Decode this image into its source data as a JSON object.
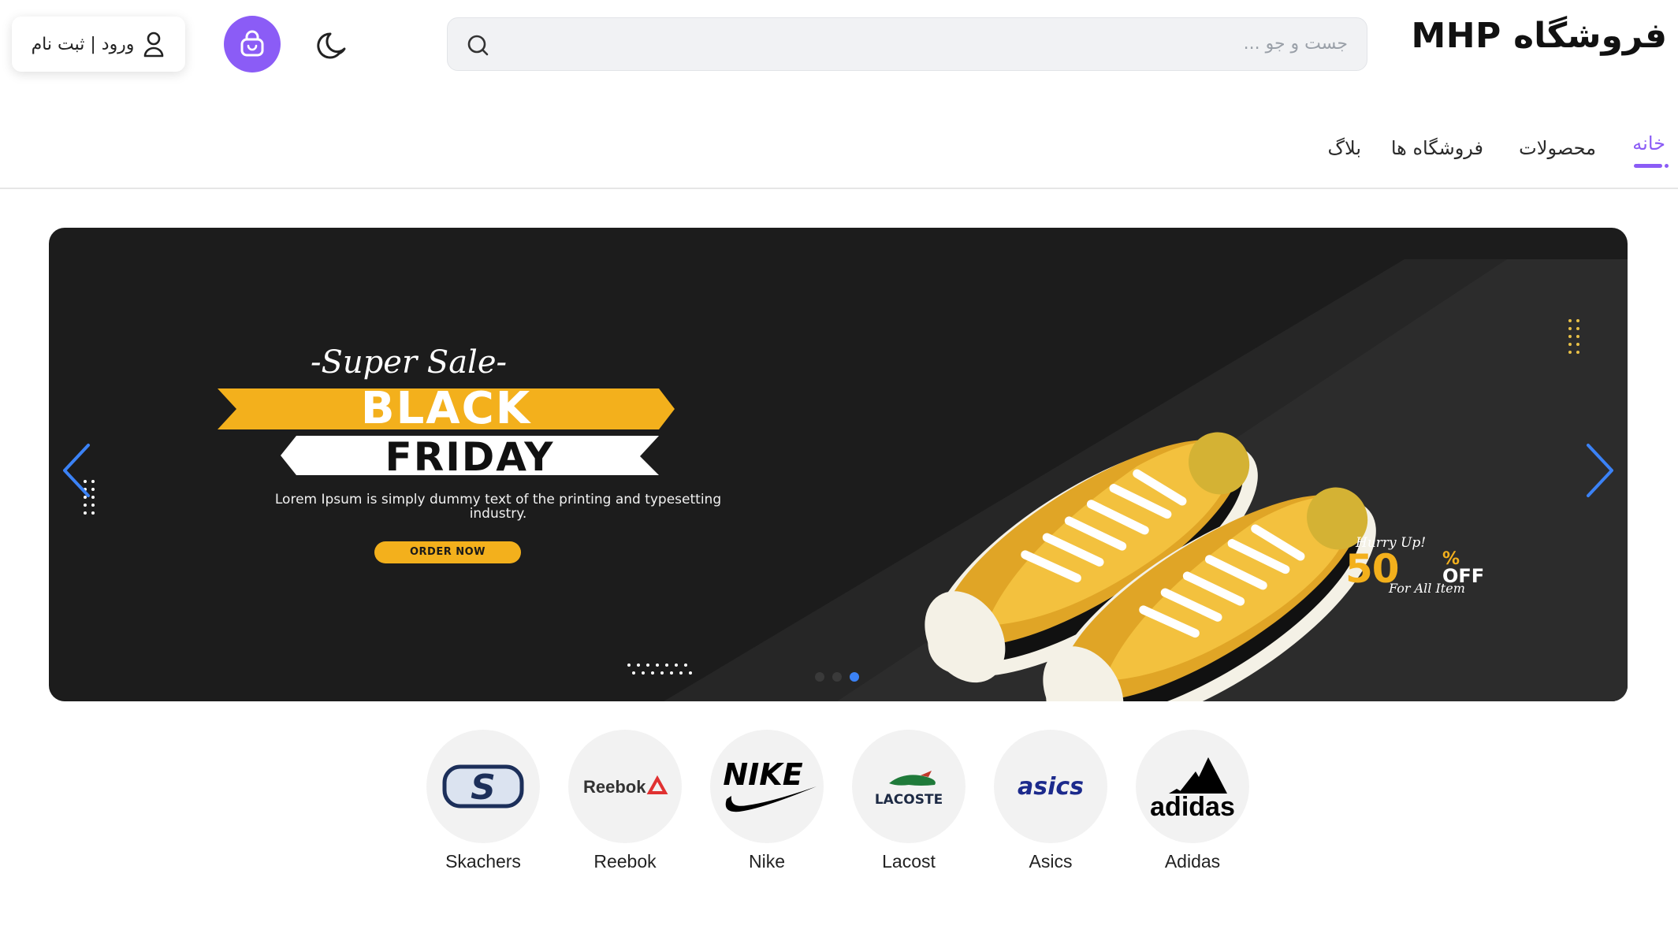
{
  "header": {
    "logo": "فروشگاه MHP",
    "search_placeholder": "جست و جو ...",
    "login_label": "ورود | ثبت نام"
  },
  "icons": {
    "search": "search-icon",
    "theme": "moon-icon",
    "cart": "shopping-bag-icon",
    "user": "user-icon"
  },
  "nav": {
    "items": [
      {
        "label": "خانه",
        "active": true
      },
      {
        "label": "محصولات",
        "active": false
      },
      {
        "label": "فروشگاه ها",
        "active": false
      },
      {
        "label": "بلاگ",
        "active": false
      }
    ]
  },
  "banner": {
    "super_sale": "-Super Sale-",
    "black": "BLACK",
    "friday": "FRIDAY",
    "lorem": "Lorem Ipsum is simply dummy text of the printing and typesetting industry.",
    "order_now": "ORDER NOW",
    "hurry": "Hurry Up!",
    "percent": "50",
    "percent_sign": "%",
    "off": "OFF",
    "for_all": "For All Item",
    "slides": 3,
    "active_slide": 3
  },
  "brands": [
    {
      "name": "Skachers",
      "logo_text": "S"
    },
    {
      "name": "Reebok",
      "logo_text": "Reebok"
    },
    {
      "name": "Nike",
      "logo_text": "NIKE"
    },
    {
      "name": "Lacost",
      "logo_text": "LACOSTE"
    },
    {
      "name": "Asics",
      "logo_text": "asics"
    },
    {
      "name": "Adidas",
      "logo_text": "adidas"
    }
  ],
  "colors": {
    "accent": "#8b5cf6",
    "banner_bg": "#1c1c1c",
    "banner_yellow": "#f3b01c",
    "carousel_active": "#3b82f6"
  }
}
